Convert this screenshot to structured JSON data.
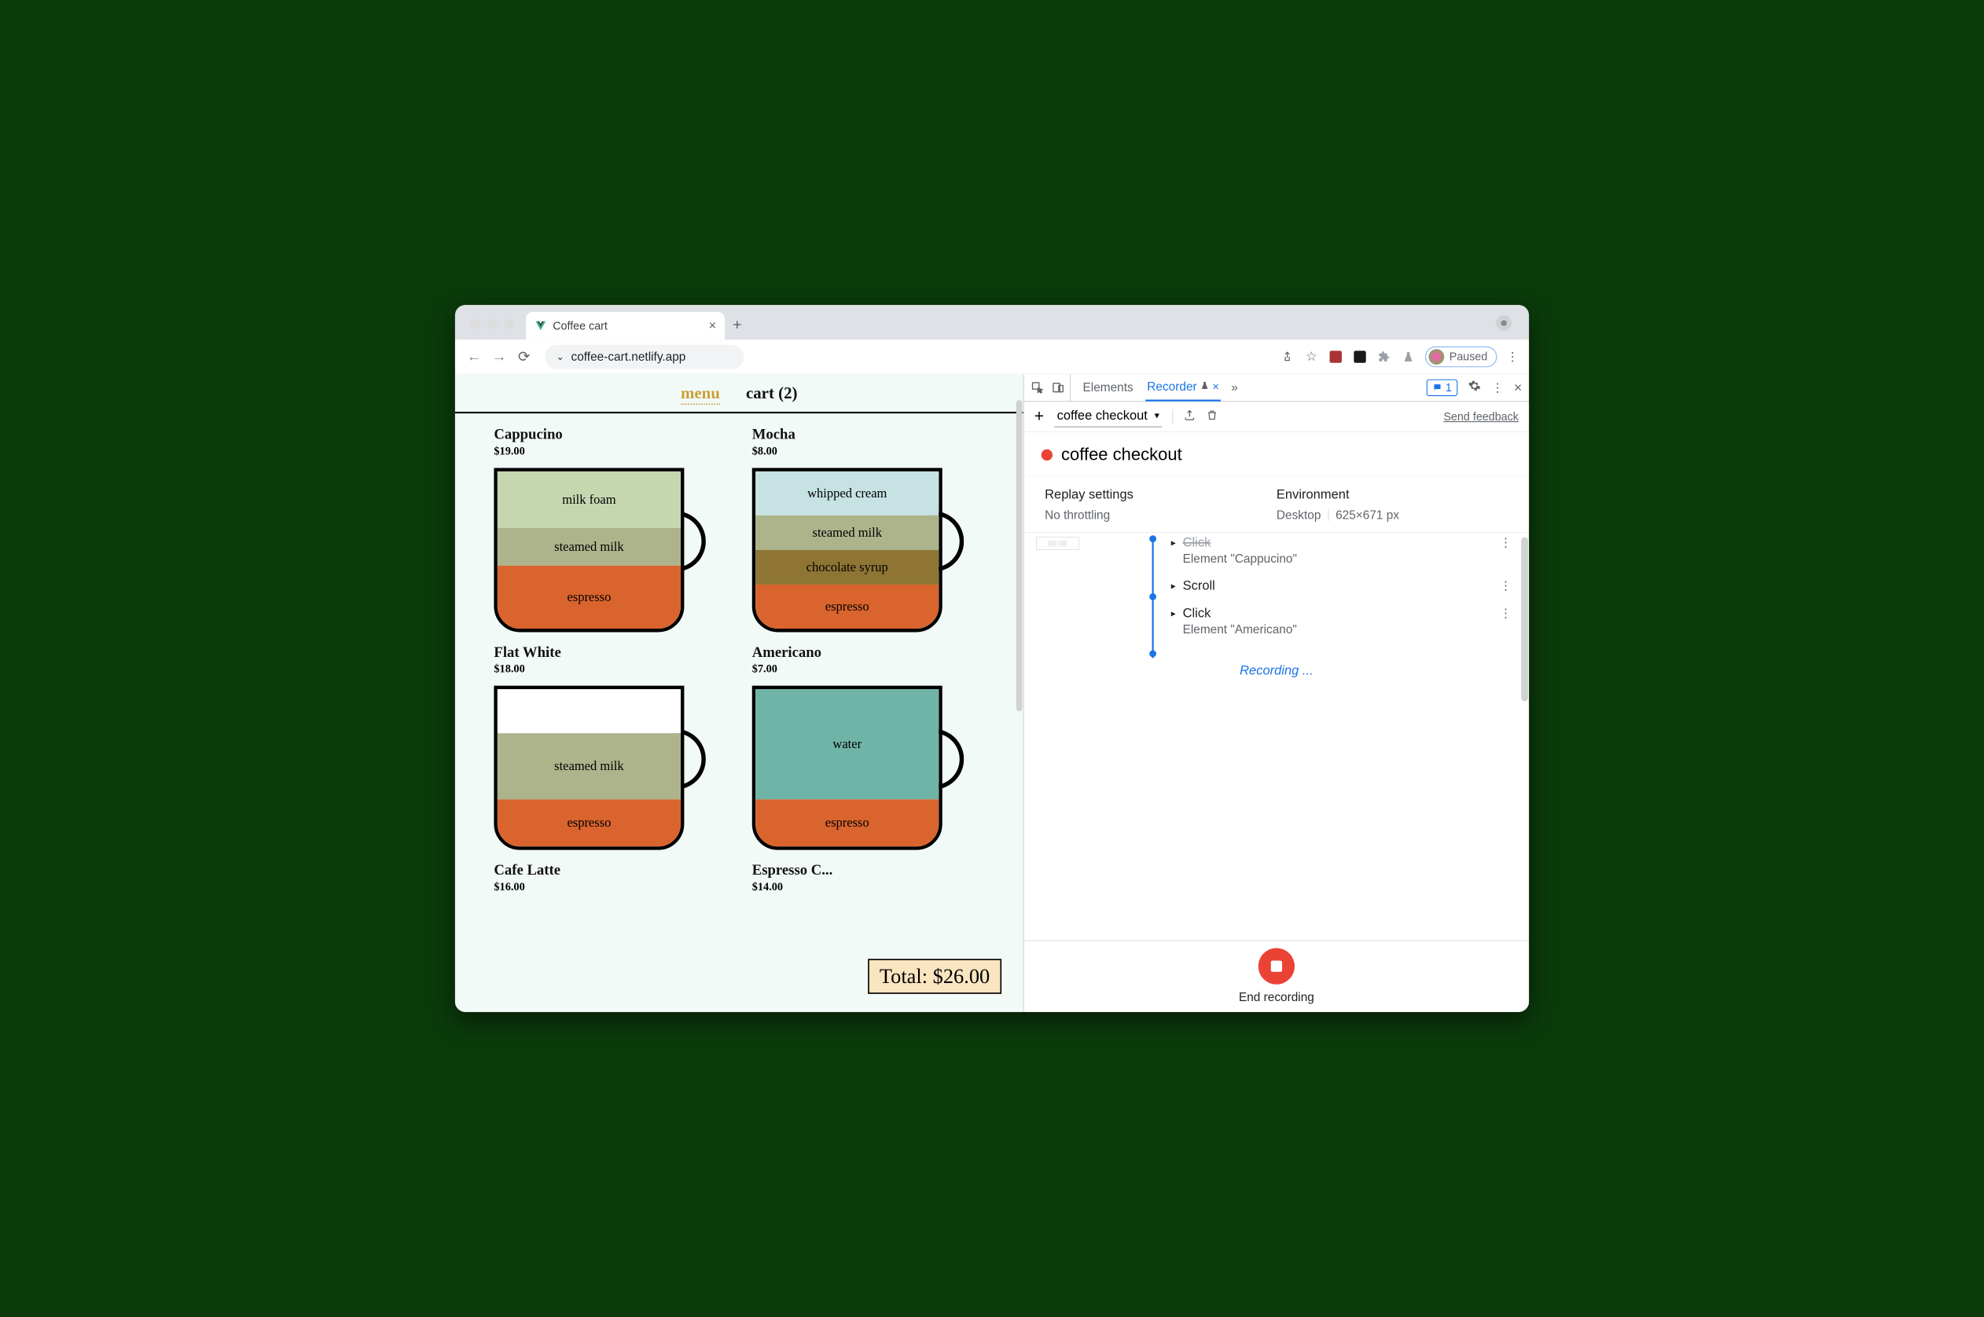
{
  "browser": {
    "tab_title": "Coffee cart",
    "url": "coffee-cart.netlify.app",
    "paused_label": "Paused"
  },
  "page": {
    "nav": {
      "menu": "menu",
      "cart": "cart (2)"
    },
    "total_label": "Total: $26.00",
    "items": [
      {
        "name": "Cappucino",
        "price": "$19.00"
      },
      {
        "name": "Mocha",
        "price": "$8.00"
      },
      {
        "name": "Flat White",
        "price": "$18.00"
      },
      {
        "name": "Americano",
        "price": "$7.00"
      },
      {
        "name": "Cafe Latte",
        "price": "$16.00"
      },
      {
        "name": "Espresso C...",
        "price": "$14.00"
      }
    ],
    "layers": {
      "milk_foam": "milk foam",
      "steamed_milk": "steamed milk",
      "espresso": "espresso",
      "whipped_cream": "whipped cream",
      "chocolate_syrup": "chocolate syrup",
      "water": "water"
    }
  },
  "devtools": {
    "tabs": {
      "elements": "Elements",
      "recorder": "Recorder"
    },
    "messages_count": "1",
    "recorder": {
      "recording_name": "coffee checkout",
      "title": "coffee checkout",
      "send_feedback": "Send feedback",
      "replay_heading": "Replay settings",
      "replay_value": "No throttling",
      "env_heading": "Environment",
      "env_device": "Desktop",
      "env_viewport": "625×671 px",
      "steps": [
        {
          "title": "Click",
          "sub": "Element \"Cappucino\"",
          "partial": true
        },
        {
          "title": "Scroll",
          "sub": ""
        },
        {
          "title": "Click",
          "sub": "Element \"Americano\""
        }
      ],
      "recording_label": "Recording ...",
      "end_label": "End recording"
    }
  }
}
